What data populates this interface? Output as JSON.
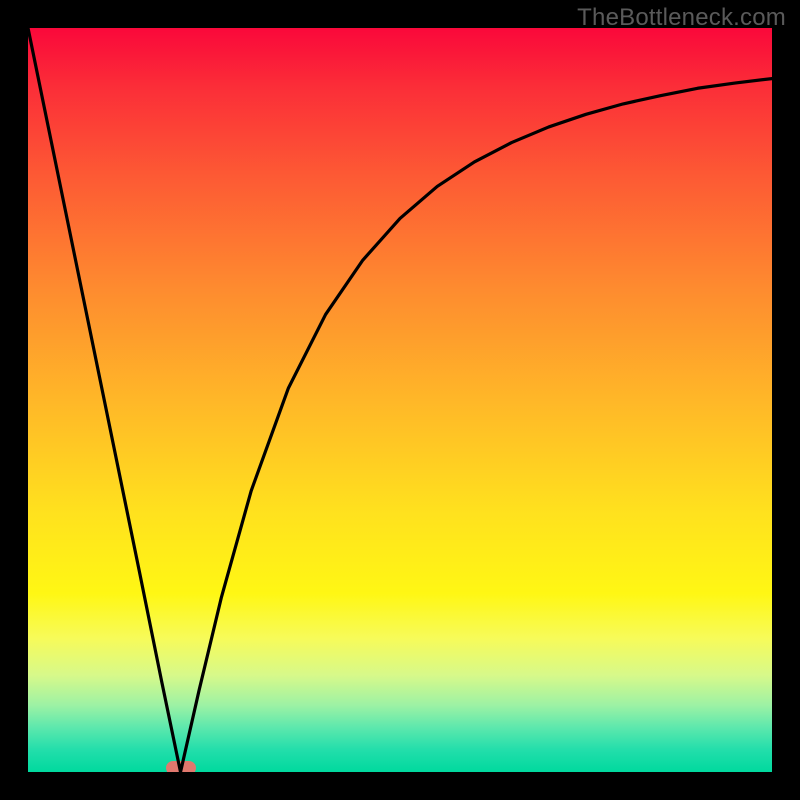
{
  "watermark": "TheBottleneck.com",
  "chart_data": {
    "type": "line",
    "title": "",
    "xlabel": "",
    "ylabel": "",
    "xlim": [
      0,
      1
    ],
    "ylim": [
      0,
      1
    ],
    "notch_x": 0.205,
    "marker": {
      "x": 0.205,
      "y": 0.0,
      "color": "#e1786e"
    },
    "series": [
      {
        "name": "curve",
        "x": [
          0.0,
          0.05,
          0.1,
          0.15,
          0.18,
          0.2,
          0.205,
          0.21,
          0.23,
          0.26,
          0.3,
          0.35,
          0.4,
          0.45,
          0.5,
          0.55,
          0.6,
          0.65,
          0.7,
          0.75,
          0.8,
          0.85,
          0.9,
          0.95,
          1.0
        ],
        "y": [
          1.0,
          0.756,
          0.512,
          0.268,
          0.12,
          0.024,
          0.0,
          0.022,
          0.11,
          0.235,
          0.378,
          0.516,
          0.615,
          0.688,
          0.744,
          0.787,
          0.82,
          0.846,
          0.867,
          0.884,
          0.898,
          0.909,
          0.919,
          0.926,
          0.932
        ]
      }
    ],
    "background_gradient": {
      "top": "#fa083a",
      "mid": "#ffe11e",
      "bottom": "#00d99e"
    }
  }
}
